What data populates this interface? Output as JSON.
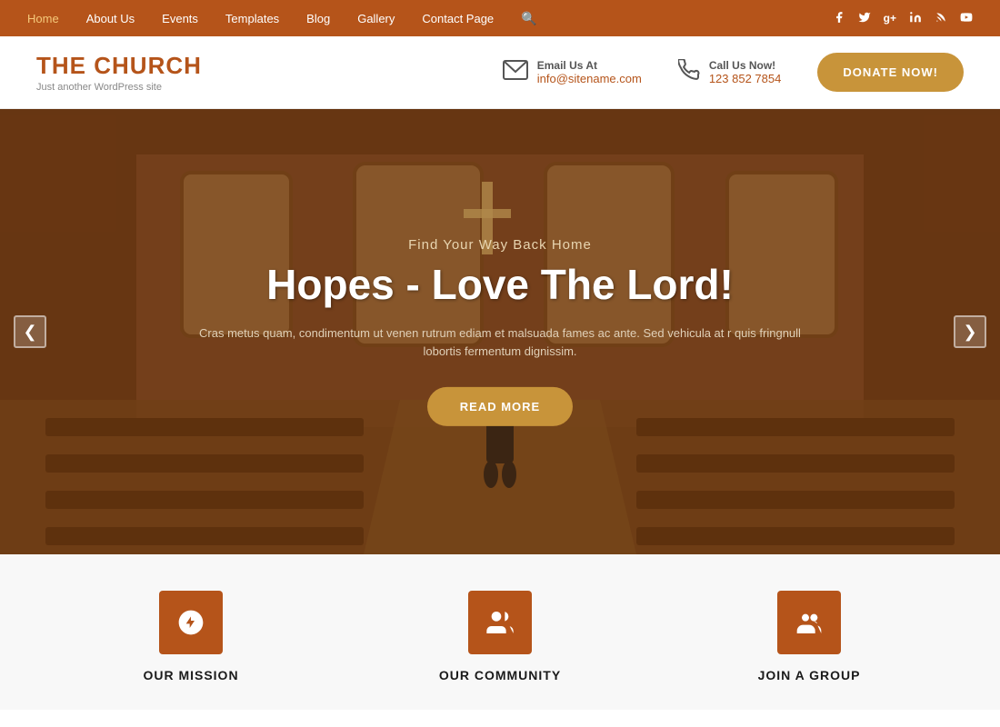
{
  "nav": {
    "links": [
      {
        "label": "Home",
        "active": true
      },
      {
        "label": "About Us",
        "active": false
      },
      {
        "label": "Events",
        "active": false
      },
      {
        "label": "Templates",
        "active": false
      },
      {
        "label": "Blog",
        "active": false
      },
      {
        "label": "Gallery",
        "active": false
      },
      {
        "label": "Contact Page",
        "active": false
      }
    ],
    "social": [
      {
        "name": "facebook-icon",
        "symbol": "f"
      },
      {
        "name": "twitter-icon",
        "symbol": "t"
      },
      {
        "name": "googleplus-icon",
        "symbol": "g+"
      },
      {
        "name": "linkedin-icon",
        "symbol": "in"
      },
      {
        "name": "rss-icon",
        "symbol": "rss"
      },
      {
        "name": "youtube-icon",
        "symbol": "▶"
      }
    ]
  },
  "header": {
    "logo_the": "THE ",
    "logo_church": "CHURCH",
    "logo_sub": "Just another WordPress site",
    "email_label": "Email Us At",
    "email_value": "info@sitename.com",
    "phone_label": "Call Us Now!",
    "phone_value": "123 852 7854",
    "donate_label": "DONATE NOW!"
  },
  "hero": {
    "subtitle": "Find Your Way Back Home",
    "title": "Hopes - Love The Lord!",
    "description": "Cras metus quam, condimentum ut venen rutrum ediam et malsuada fames ac ante. Sed vehicula at r quis fringnull lobortis fermentum dignissim.",
    "cta_label": "READ MORE",
    "arrow_left": "❮",
    "arrow_right": "❯"
  },
  "cards": [
    {
      "icon": "leaf-icon",
      "title": "OUR MISSION"
    },
    {
      "icon": "community-icon",
      "title": "OUR COMMUNITY"
    },
    {
      "icon": "group-icon",
      "title": "JOIN A GROUP"
    }
  ],
  "colors": {
    "brand": "#b5541a",
    "gold": "#c8943a",
    "nav_bg": "#b5541a"
  }
}
